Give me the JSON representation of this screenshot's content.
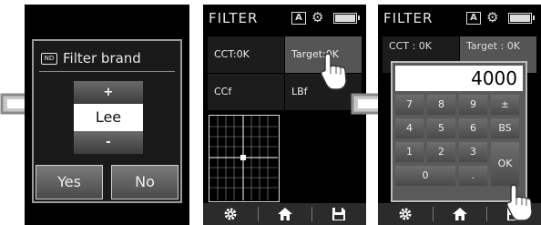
{
  "screen1": {
    "dialog_title": "Filter brand",
    "dialog_icon": "filter-icon",
    "spinner": {
      "plus": "+",
      "value": "Lee",
      "minus": "-"
    },
    "yes": "Yes",
    "no": "No"
  },
  "screen2": {
    "header": {
      "title": "FILTER",
      "mode": "A"
    },
    "buttons": {
      "cct": "CCT:0K",
      "target": "Target:0K",
      "ccf": "CCf",
      "lbf": "LBf"
    }
  },
  "screen3": {
    "header": {
      "title": "FILTER",
      "mode": "A"
    },
    "background": {
      "cct": "CCT : 0K",
      "target": "Target : 0K"
    },
    "display": "4000",
    "keys": [
      {
        "label": "7"
      },
      {
        "label": "8"
      },
      {
        "label": "9"
      },
      {
        "label": "±"
      },
      {
        "label": "4"
      },
      {
        "label": "5"
      },
      {
        "label": "6"
      },
      {
        "label": "BS"
      },
      {
        "label": "1"
      },
      {
        "label": "2"
      },
      {
        "label": "3"
      },
      {
        "label": "0"
      },
      {
        "label": "."
      },
      {
        "label": "OK"
      }
    ]
  },
  "footer": {
    "icons": [
      "gear-icon",
      "home-icon",
      "save-icon"
    ]
  },
  "colors": {
    "screen": "#000000",
    "accent_selected": "#555555",
    "footer": "#2b2b2b"
  }
}
